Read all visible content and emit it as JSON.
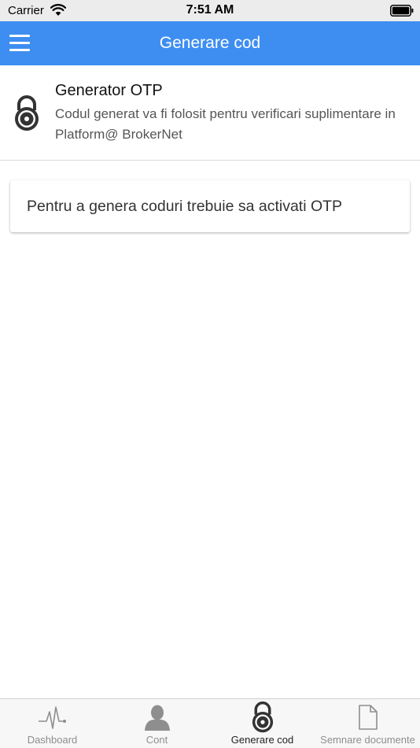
{
  "status_bar": {
    "carrier": "Carrier",
    "time": "7:51 AM"
  },
  "nav_bar": {
    "title": "Generare cod",
    "menu_icon": "hamburger-icon",
    "background_color": "#3e8ef1"
  },
  "otp_header": {
    "title": "Generator OTP",
    "description": "Codul generat va fi folosit pentru verificari suplimentare in Platform@ BrokerNet",
    "icon": "combination-lock-icon"
  },
  "info_card": {
    "message": "Pentru a genera coduri trebuie sa activati OTP"
  },
  "tab_bar": {
    "tabs": [
      {
        "label": "Dashboard",
        "icon": "pulse-icon",
        "active": false
      },
      {
        "label": "Cont",
        "icon": "user-icon",
        "active": false
      },
      {
        "label": "Generare cod",
        "icon": "lock-icon",
        "active": true
      },
      {
        "label": "Semnare documente",
        "icon": "document-icon",
        "active": false
      }
    ]
  }
}
